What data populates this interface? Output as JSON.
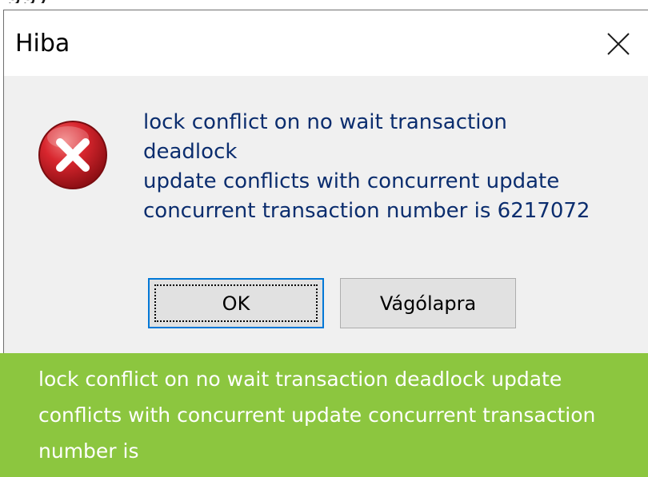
{
  "dialog": {
    "title": "Hiba",
    "message_lines": [
      "lock conflict on no wait transaction",
      "deadlock",
      "update conflicts with concurrent update",
      "concurrent transaction number is 6217072"
    ],
    "buttons": {
      "ok_label": "OK",
      "copy_label": "Vágólapra"
    },
    "icons": {
      "close": "close-icon",
      "error": "error-icon"
    }
  },
  "banner": {
    "text": "lock conflict on no wait transaction deadlock update conflicts with concurrent update concurrent transaction number is"
  },
  "colors": {
    "banner_bg": "#8cc63f",
    "message_text": "#0b2d6e",
    "error_red": "#d8262e",
    "focus_blue": "#0078d7"
  }
}
